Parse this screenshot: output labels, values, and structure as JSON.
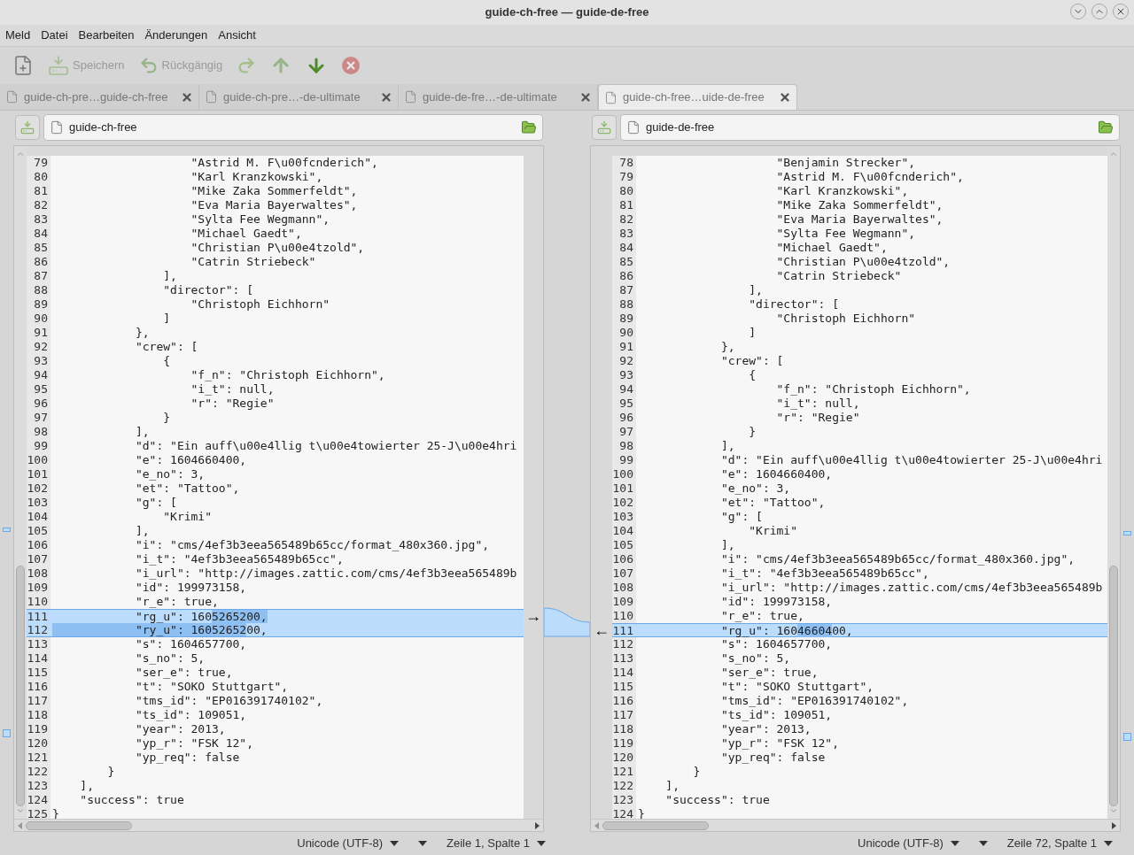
{
  "window": {
    "title": "guide-ch-free — guide-de-free"
  },
  "menu": [
    "Meld",
    "Datei",
    "Bearbeiten",
    "Änderungen",
    "Ansicht"
  ],
  "toolbar": [
    {
      "kind": "new",
      "disabled": false
    },
    {
      "kind": "save",
      "label": "Speichern",
      "disabled": true
    },
    {
      "kind": "undo",
      "label": "Rückgängig",
      "disabled": true
    },
    {
      "kind": "redo",
      "disabled": true
    },
    {
      "kind": "up",
      "disabled": true
    },
    {
      "kind": "down",
      "disabled": false
    },
    {
      "kind": "stop",
      "disabled": true
    }
  ],
  "tabs": [
    {
      "label": "guide-ch-pre…guide-ch-free",
      "selected": false
    },
    {
      "label": "guide-ch-pre…-de-ultimate",
      "selected": false
    },
    {
      "label": "guide-de-fre…-de-ultimate",
      "selected": false
    },
    {
      "label": "guide-ch-free…uide-de-free",
      "selected": true
    }
  ],
  "panes": [
    {
      "file": "guide-ch-free",
      "merge_arrow": "→",
      "encoding": "Unicode (UTF-8)",
      "position": "Zeile 1, Spalte 1",
      "lines": [
        {
          "n": "79",
          "changed": false,
          "text": "                    \"Astrid M. F\\u00fcnderich\","
        },
        {
          "n": "80",
          "changed": false,
          "text": "                    \"Karl Kranzkowski\","
        },
        {
          "n": "81",
          "changed": false,
          "text": "                    \"Mike Zaka Sommerfeldt\","
        },
        {
          "n": "82",
          "changed": false,
          "text": "                    \"Eva Maria Bayerwaltes\","
        },
        {
          "n": "83",
          "changed": false,
          "text": "                    \"Sylta Fee Wegmann\","
        },
        {
          "n": "84",
          "changed": false,
          "text": "                    \"Michael Gaedt\","
        },
        {
          "n": "85",
          "changed": false,
          "text": "                    \"Christian P\\u00e4tzold\","
        },
        {
          "n": "86",
          "changed": false,
          "text": "                    \"Catrin Striebeck\""
        },
        {
          "n": "87",
          "changed": false,
          "text": "                ],"
        },
        {
          "n": "88",
          "changed": false,
          "text": "                \"director\": ["
        },
        {
          "n": "89",
          "changed": false,
          "text": "                    \"Christoph Eichhorn\""
        },
        {
          "n": "90",
          "changed": false,
          "text": "                ]"
        },
        {
          "n": "91",
          "changed": false,
          "text": "            },"
        },
        {
          "n": "92",
          "changed": false,
          "text": "            \"crew\": ["
        },
        {
          "n": "93",
          "changed": false,
          "text": "                {"
        },
        {
          "n": "94",
          "changed": false,
          "text": "                    \"f_n\": \"Christoph Eichhorn\","
        },
        {
          "n": "95",
          "changed": false,
          "text": "                    \"i_t\": null,"
        },
        {
          "n": "96",
          "changed": false,
          "text": "                    \"r\": \"Regie\""
        },
        {
          "n": "97",
          "changed": false,
          "text": "                }"
        },
        {
          "n": "98",
          "changed": false,
          "text": "            ],"
        },
        {
          "n": "99",
          "changed": false,
          "text": "            \"d\": \"Ein auff\\u00e4llig t\\u00e4towierter 25-J\\u00e4hri"
        },
        {
          "n": "100",
          "changed": false,
          "text": "            \"e\": 1604660400,"
        },
        {
          "n": "101",
          "changed": false,
          "text": "            \"e_no\": 3,"
        },
        {
          "n": "102",
          "changed": false,
          "text": "            \"et\": \"Tattoo\","
        },
        {
          "n": "103",
          "changed": false,
          "text": "            \"g\": ["
        },
        {
          "n": "104",
          "changed": false,
          "text": "                \"Krimi\""
        },
        {
          "n": "105",
          "changed": false,
          "text": "            ],"
        },
        {
          "n": "106",
          "changed": false,
          "text": "            \"i\": \"cms/4ef3b3eea565489b65cc/format_480x360.jpg\","
        },
        {
          "n": "107",
          "changed": false,
          "text": "            \"i_t\": \"4ef3b3eea565489b65cc\","
        },
        {
          "n": "108",
          "changed": false,
          "text": "            \"i_url\": \"http://images.zattic.com/cms/4ef3b3eea565489b"
        },
        {
          "n": "109",
          "changed": false,
          "text": "            \"id\": 199973158,"
        },
        {
          "n": "110",
          "changed": false,
          "text": "            \"r_e\": true,"
        },
        {
          "n": "111",
          "changed": true,
          "segments": [
            {
              "text": "            \"rg_u\": 160",
              "emph": false
            },
            {
              "text": "5265200,",
              "emph": true
            }
          ]
        },
        {
          "n": "112",
          "changed": true,
          "segments": [
            {
              "text": "            \"ry_u\": 16052652",
              "emph": true
            },
            {
              "text": "00,",
              "emph": false
            }
          ]
        },
        {
          "n": "113",
          "changed": false,
          "text": "            \"s\": 1604657700,"
        },
        {
          "n": "114",
          "changed": false,
          "text": "            \"s_no\": 5,"
        },
        {
          "n": "115",
          "changed": false,
          "text": "            \"ser_e\": true,"
        },
        {
          "n": "116",
          "changed": false,
          "text": "            \"t\": \"SOKO Stuttgart\","
        },
        {
          "n": "117",
          "changed": false,
          "text": "            \"tms_id\": \"EP016391740102\","
        },
        {
          "n": "118",
          "changed": false,
          "text": "            \"ts_id\": 109051,"
        },
        {
          "n": "119",
          "changed": false,
          "text": "            \"year\": 2013,"
        },
        {
          "n": "120",
          "changed": false,
          "text": "            \"yp_r\": \"FSK 12\","
        },
        {
          "n": "121",
          "changed": false,
          "text": "            \"yp_req\": false"
        },
        {
          "n": "122",
          "changed": false,
          "text": "        }"
        },
        {
          "n": "123",
          "changed": false,
          "text": "    ],"
        },
        {
          "n": "124",
          "changed": false,
          "text": "    \"success\": true"
        },
        {
          "n": "125",
          "changed": false,
          "text": "}"
        }
      ]
    },
    {
      "file": "guide-de-free",
      "merge_arrow": "←",
      "encoding": "Unicode (UTF-8)",
      "position": "Zeile 72, Spalte 1",
      "lines": [
        {
          "n": "78",
          "changed": false,
          "text": "                    \"Benjamin Strecker\","
        },
        {
          "n": "79",
          "changed": false,
          "text": "                    \"Astrid M. F\\u00fcnderich\","
        },
        {
          "n": "80",
          "changed": false,
          "text": "                    \"Karl Kranzkowski\","
        },
        {
          "n": "81",
          "changed": false,
          "text": "                    \"Mike Zaka Sommerfeldt\","
        },
        {
          "n": "82",
          "changed": false,
          "text": "                    \"Eva Maria Bayerwaltes\","
        },
        {
          "n": "83",
          "changed": false,
          "text": "                    \"Sylta Fee Wegmann\","
        },
        {
          "n": "84",
          "changed": false,
          "text": "                    \"Michael Gaedt\","
        },
        {
          "n": "85",
          "changed": false,
          "text": "                    \"Christian P\\u00e4tzold\","
        },
        {
          "n": "86",
          "changed": false,
          "text": "                    \"Catrin Striebeck\""
        },
        {
          "n": "87",
          "changed": false,
          "text": "                ],"
        },
        {
          "n": "88",
          "changed": false,
          "text": "                \"director\": ["
        },
        {
          "n": "89",
          "changed": false,
          "text": "                    \"Christoph Eichhorn\""
        },
        {
          "n": "90",
          "changed": false,
          "text": "                ]"
        },
        {
          "n": "91",
          "changed": false,
          "text": "            },"
        },
        {
          "n": "92",
          "changed": false,
          "text": "            \"crew\": ["
        },
        {
          "n": "93",
          "changed": false,
          "text": "                {"
        },
        {
          "n": "94",
          "changed": false,
          "text": "                    \"f_n\": \"Christoph Eichhorn\","
        },
        {
          "n": "95",
          "changed": false,
          "text": "                    \"i_t\": null,"
        },
        {
          "n": "96",
          "changed": false,
          "text": "                    \"r\": \"Regie\""
        },
        {
          "n": "97",
          "changed": false,
          "text": "                }"
        },
        {
          "n": "98",
          "changed": false,
          "text": "            ],"
        },
        {
          "n": "99",
          "changed": false,
          "text": "            \"d\": \"Ein auff\\u00e4llig t\\u00e4towierter 25-J\\u00e4hri"
        },
        {
          "n": "100",
          "changed": false,
          "text": "            \"e\": 1604660400,"
        },
        {
          "n": "101",
          "changed": false,
          "text": "            \"e_no\": 3,"
        },
        {
          "n": "102",
          "changed": false,
          "text": "            \"et\": \"Tattoo\","
        },
        {
          "n": "103",
          "changed": false,
          "text": "            \"g\": ["
        },
        {
          "n": "104",
          "changed": false,
          "text": "                \"Krimi\""
        },
        {
          "n": "105",
          "changed": false,
          "text": "            ],"
        },
        {
          "n": "106",
          "changed": false,
          "text": "            \"i\": \"cms/4ef3b3eea565489b65cc/format_480x360.jpg\","
        },
        {
          "n": "107",
          "changed": false,
          "text": "            \"i_t\": \"4ef3b3eea565489b65cc\","
        },
        {
          "n": "108",
          "changed": false,
          "text": "            \"i_url\": \"http://images.zattic.com/cms/4ef3b3eea565489b"
        },
        {
          "n": "109",
          "changed": false,
          "text": "            \"id\": 199973158,"
        },
        {
          "n": "110",
          "changed": false,
          "text": "            \"r_e\": true,"
        },
        {
          "n": "111",
          "changed": true,
          "segments": [
            {
              "text": "            \"rg_u\": 160",
              "emph": false
            },
            {
              "text": "46604",
              "emph": true
            },
            {
              "text": "00,",
              "emph": false
            }
          ]
        },
        {
          "n": "112",
          "changed": false,
          "text": "            \"s\": 1604657700,"
        },
        {
          "n": "113",
          "changed": false,
          "text": "            \"s_no\": 5,"
        },
        {
          "n": "114",
          "changed": false,
          "text": "            \"ser_e\": true,"
        },
        {
          "n": "115",
          "changed": false,
          "text": "            \"t\": \"SOKO Stuttgart\","
        },
        {
          "n": "116",
          "changed": false,
          "text": "            \"tms_id\": \"EP016391740102\","
        },
        {
          "n": "117",
          "changed": false,
          "text": "            \"ts_id\": 109051,"
        },
        {
          "n": "118",
          "changed": false,
          "text": "            \"year\": 2013,"
        },
        {
          "n": "119",
          "changed": false,
          "text": "            \"yp_r\": \"FSK 12\","
        },
        {
          "n": "120",
          "changed": false,
          "text": "            \"yp_req\": false"
        },
        {
          "n": "121",
          "changed": false,
          "text": "        }"
        },
        {
          "n": "122",
          "changed": false,
          "text": "    ],"
        },
        {
          "n": "123",
          "changed": false,
          "text": "    \"success\": true"
        },
        {
          "n": "124",
          "changed": false,
          "text": "}"
        }
      ]
    }
  ]
}
